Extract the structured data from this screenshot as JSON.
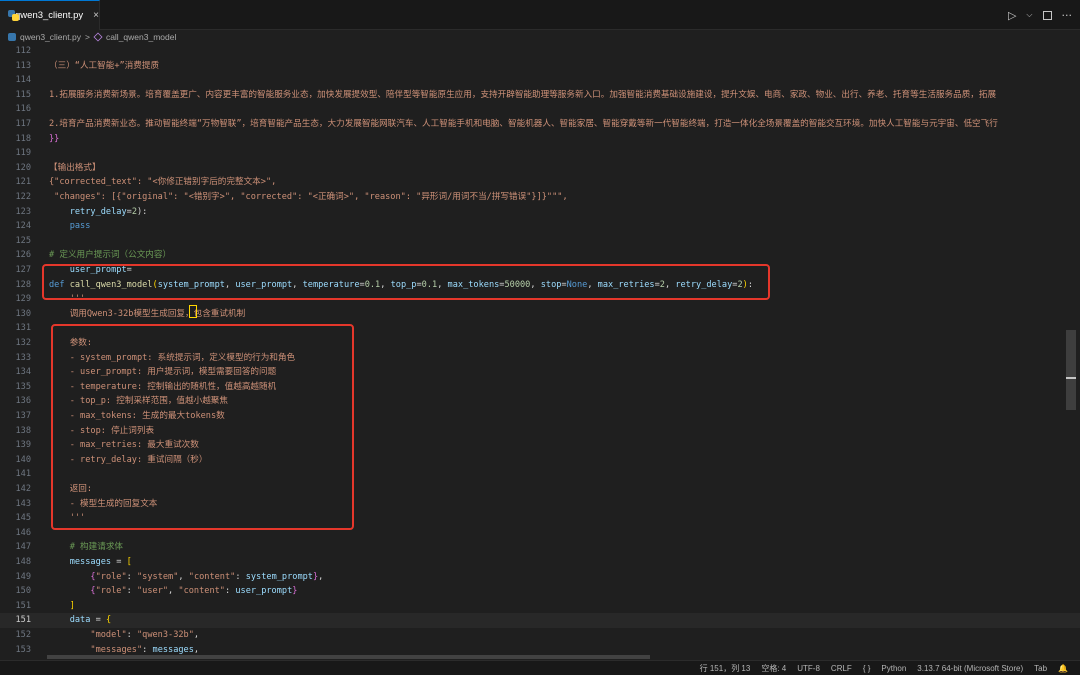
{
  "tab": {
    "title": "qwen3_client.py",
    "close": "×"
  },
  "breadcrumb": {
    "file": "qwen3_client.py",
    "separator": ">",
    "symbol": "call_qwen3_model"
  },
  "actions": {
    "run": "▷",
    "dropdown": "⌵",
    "more": "···"
  },
  "lines": [
    {
      "n": "112",
      "t": []
    },
    {
      "n": "113",
      "t": [
        [
          "c-str",
          "（三）“人工智能+”消费提质"
        ]
      ]
    },
    {
      "n": "114",
      "t": []
    },
    {
      "n": "115",
      "t": [
        [
          "c-str",
          "1.拓展服务消费新场景。培育覆盖更广、内容更丰富的智能服务业态，加快发展提效型、陪伴型等智能原生应用，支持开辟智能助理等服务新入口。加强智能消费基础设施建设，提升文娱、电商、家政、物业、出行、养老、托育等生活服务品质，拓展"
        ]
      ]
    },
    {
      "n": "116",
      "t": []
    },
    {
      "n": "117",
      "t": [
        [
          "c-str",
          "2.培育产品消费新业态。推动智能终端“万物智联”，培育智能产品生态，大力发展智能网联汽车、人工智能手机和电脑、智能机器人、智能家居、智能穿戴等新一代智能终端，打造一体化全场景覆盖的智能交互环境。加快人工智能与元宇宙、低空飞行"
        ]
      ]
    },
    {
      "n": "118",
      "t": [
        [
          "c-br2",
          "}}"
        ]
      ]
    },
    {
      "n": "119",
      "t": []
    },
    {
      "n": "120",
      "t": [
        [
          "c-str",
          "【输出格式】"
        ]
      ]
    },
    {
      "n": "121",
      "t": [
        [
          "c-str",
          "{\"corrected_text\": \"<你修正错别字后的完整文本>\","
        ]
      ]
    },
    {
      "n": "122",
      "t": [
        [
          "c-str",
          " \"changes\": [{\"original\": \"<错别字>\", \"corrected\": \"<正确词>\", \"reason\": \"异形词/用词不当/拼写错误\"}]}\"\"\","
        ]
      ]
    },
    {
      "n": "123",
      "t": [
        [
          "c-plain",
          "    "
        ],
        [
          "c-var",
          "retry_delay"
        ],
        [
          "c-plain",
          "="
        ],
        [
          "c-num",
          "2"
        ],
        [
          "c-plain",
          "):"
        ]
      ]
    },
    {
      "n": "124",
      "t": [
        [
          "c-plain",
          "    "
        ],
        [
          "c-kw",
          "pass"
        ]
      ]
    },
    {
      "n": "125",
      "t": []
    },
    {
      "n": "126",
      "t": [
        [
          "c-cm",
          "# 定义用户提示词（公文内容）"
        ]
      ]
    },
    {
      "n": "127",
      "t": [
        [
          "c-plain",
          "    "
        ],
        [
          "c-var",
          "user_prompt"
        ],
        [
          "c-plain",
          "="
        ]
      ]
    },
    {
      "n": "128",
      "t": [
        [
          "c-kw",
          "def "
        ],
        [
          "c-fn",
          "call_qwen3_model"
        ],
        [
          "c-br",
          "("
        ],
        [
          "c-var",
          "system_prompt"
        ],
        [
          "c-plain",
          ", "
        ],
        [
          "c-var",
          "user_prompt"
        ],
        [
          "c-plain",
          ", "
        ],
        [
          "c-var",
          "temperature"
        ],
        [
          "c-plain",
          "="
        ],
        [
          "c-num",
          "0.1"
        ],
        [
          "c-plain",
          ", "
        ],
        [
          "c-var",
          "top_p"
        ],
        [
          "c-plain",
          "="
        ],
        [
          "c-num",
          "0.1"
        ],
        [
          "c-plain",
          ", "
        ],
        [
          "c-var",
          "max_tokens"
        ],
        [
          "c-plain",
          "="
        ],
        [
          "c-num",
          "50000"
        ],
        [
          "c-plain",
          ", "
        ],
        [
          "c-var",
          "stop"
        ],
        [
          "c-plain",
          "="
        ],
        [
          "c-kw",
          "None"
        ],
        [
          "c-plain",
          ", "
        ],
        [
          "c-var",
          "max_retries"
        ],
        [
          "c-plain",
          "="
        ],
        [
          "c-num",
          "2"
        ],
        [
          "c-plain",
          ", "
        ],
        [
          "c-var",
          "retry_delay"
        ],
        [
          "c-plain",
          "="
        ],
        [
          "c-num",
          "2"
        ],
        [
          "c-br",
          ")"
        ],
        [
          "c-plain",
          ":"
        ]
      ]
    },
    {
      "n": "129",
      "t": [
        [
          "c-str",
          "    '''"
        ]
      ]
    },
    {
      "n": "130",
      "t": [
        [
          "c-str",
          "    调用Qwen3-32b模型生成回复，包含重试机制"
        ]
      ]
    },
    {
      "n": "131",
      "t": []
    },
    {
      "n": "132",
      "t": [
        [
          "c-str",
          "    参数:"
        ]
      ]
    },
    {
      "n": "133",
      "t": [
        [
          "c-str",
          "    - system_prompt: 系统提示词，定义模型的行为和角色"
        ]
      ]
    },
    {
      "n": "134",
      "t": [
        [
          "c-str",
          "    - user_prompt: 用户提示词，模型需要回答的问题"
        ]
      ]
    },
    {
      "n": "135",
      "t": [
        [
          "c-str",
          "    - temperature: 控制输出的随机性，值越高越随机"
        ]
      ]
    },
    {
      "n": "136",
      "t": [
        [
          "c-str",
          "    - top_p: 控制采样范围，值越小越聚焦"
        ]
      ]
    },
    {
      "n": "137",
      "t": [
        [
          "c-str",
          "    - max_tokens: 生成的最大tokens数"
        ]
      ]
    },
    {
      "n": "138",
      "t": [
        [
          "c-str",
          "    - stop: 停止词列表"
        ]
      ]
    },
    {
      "n": "139",
      "t": [
        [
          "c-str",
          "    - max_retries: 最大重试次数"
        ]
      ]
    },
    {
      "n": "140",
      "t": [
        [
          "c-str",
          "    - retry_delay: 重试间隔（秒）"
        ]
      ]
    },
    {
      "n": "141",
      "t": []
    },
    {
      "n": "142",
      "t": [
        [
          "c-str",
          "    返回:"
        ]
      ]
    },
    {
      "n": "143",
      "t": [
        [
          "c-str",
          "    - 模型生成的回复文本"
        ]
      ]
    },
    {
      "n": "145",
      "t": [
        [
          "c-str",
          "    '''"
        ]
      ]
    },
    {
      "n": "146",
      "t": []
    },
    {
      "n": "147",
      "t": [
        [
          "c-plain",
          "    "
        ],
        [
          "c-cm",
          "# 构建请求体"
        ]
      ]
    },
    {
      "n": "148",
      "t": [
        [
          "c-plain",
          "    "
        ],
        [
          "c-var",
          "messages"
        ],
        [
          "c-plain",
          " = "
        ],
        [
          "c-br",
          "["
        ]
      ]
    },
    {
      "n": "149",
      "t": [
        [
          "c-plain",
          "        "
        ],
        [
          "c-br2",
          "{"
        ],
        [
          "c-str",
          "\"role\""
        ],
        [
          "c-plain",
          ": "
        ],
        [
          "c-str",
          "\"system\""
        ],
        [
          "c-plain",
          ", "
        ],
        [
          "c-str",
          "\"content\""
        ],
        [
          "c-plain",
          ": "
        ],
        [
          "c-var",
          "system_prompt"
        ],
        [
          "c-br2",
          "}"
        ],
        [
          "c-plain",
          ","
        ]
      ]
    },
    {
      "n": "150",
      "t": [
        [
          "c-plain",
          "        "
        ],
        [
          "c-br2",
          "{"
        ],
        [
          "c-str",
          "\"role\""
        ],
        [
          "c-plain",
          ": "
        ],
        [
          "c-str",
          "\"user\""
        ],
        [
          "c-plain",
          ", "
        ],
        [
          "c-str",
          "\"content\""
        ],
        [
          "c-plain",
          ": "
        ],
        [
          "c-var",
          "user_prompt"
        ],
        [
          "c-br2",
          "}"
        ]
      ]
    },
    {
      "n": "151",
      "t": [
        [
          "c-plain",
          "    "
        ],
        [
          "c-br",
          "]"
        ]
      ]
    },
    {
      "n": "151",
      "t": [
        [
          "c-plain",
          "    "
        ],
        [
          "c-var",
          "data"
        ],
        [
          "c-plain",
          " = "
        ],
        [
          "c-br",
          "{"
        ]
      ],
      "current": true
    },
    {
      "n": "152",
      "t": [
        [
          "c-plain",
          "        "
        ],
        [
          "c-str",
          "\"model\""
        ],
        [
          "c-plain",
          ": "
        ],
        [
          "c-str",
          "\"qwen3-32b\""
        ],
        [
          "c-plain",
          ","
        ]
      ]
    },
    {
      "n": "153",
      "t": [
        [
          "c-plain",
          "        "
        ],
        [
          "c-str",
          "\"messages\""
        ],
        [
          "c-plain",
          ": "
        ],
        [
          "c-var",
          "messages"
        ],
        [
          "c-plain",
          ","
        ]
      ]
    }
  ],
  "status": {
    "position": "行 151，列 13",
    "spaces": "空格: 4",
    "encoding": "UTF-8",
    "eol": "CRLF",
    "braces": "{ }",
    "language": "Python",
    "interpreter": "3.13.7 64-bit (Microsoft Store)",
    "tab": "Tab",
    "bell": "🔔"
  }
}
